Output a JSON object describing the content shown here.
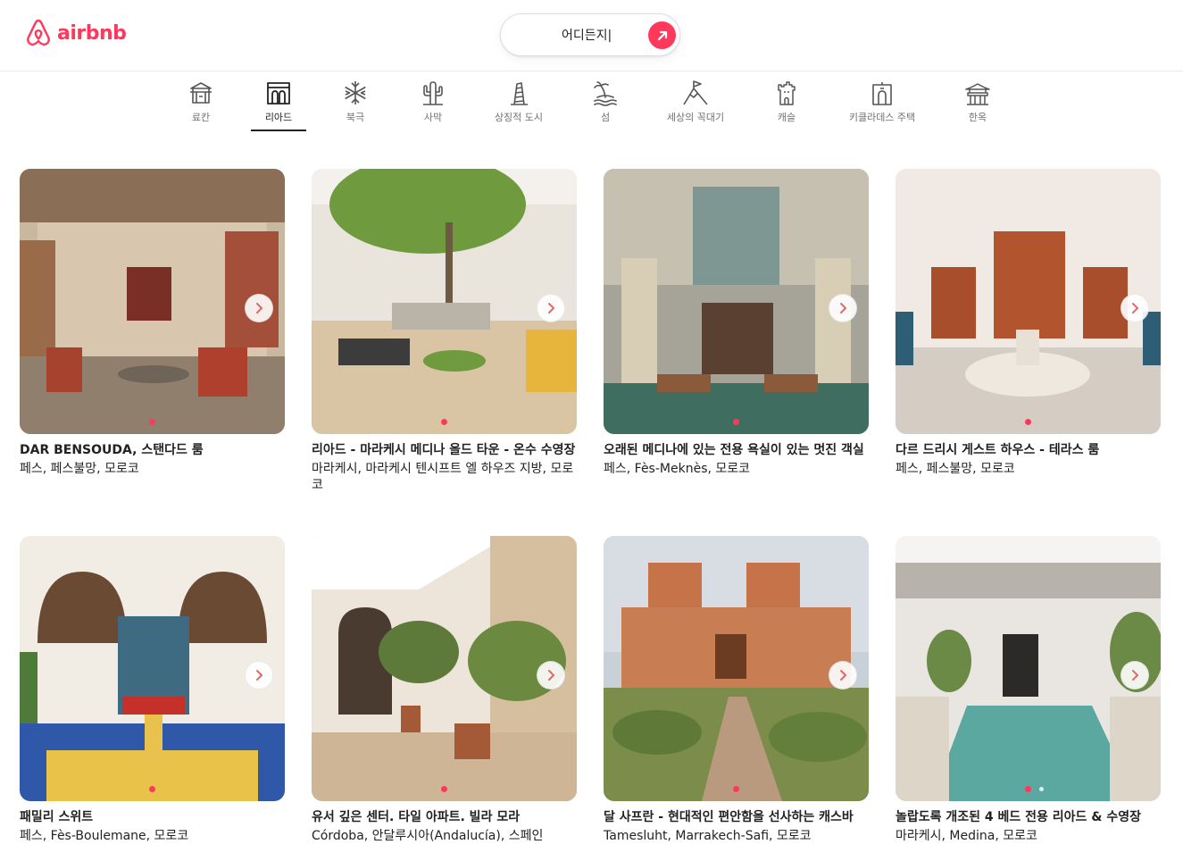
{
  "header": {
    "logo_text": "airbnb",
    "search_text": "어디든지|"
  },
  "categories": [
    {
      "label": "료칸",
      "icon": "ryokan-icon"
    },
    {
      "label": "리아드",
      "icon": "riad-icon",
      "active": true
    },
    {
      "label": "북극",
      "icon": "snowflake-icon"
    },
    {
      "label": "사막",
      "icon": "cactus-icon"
    },
    {
      "label": "상징적 도시",
      "icon": "tower-icon"
    },
    {
      "label": "섬",
      "icon": "island-icon"
    },
    {
      "label": "세상의 꼭대기",
      "icon": "mountain-flag-icon"
    },
    {
      "label": "캐슬",
      "icon": "castle-icon"
    },
    {
      "label": "키클라데스 주택",
      "icon": "cycladic-house-icon"
    },
    {
      "label": "한옥",
      "icon": "hanok-icon"
    }
  ],
  "listings": [
    {
      "title": "DAR BENSOUDA, 스탠다드 룸",
      "location": "페스, 페스불망, 모로코"
    },
    {
      "title": "리아드 - 마라케시 메디나 올드 타운 - 온수 수영장",
      "location": "마라케시, 마라케시 텐시프트 엘 하우즈 지방, 모로코"
    },
    {
      "title": "오래된 메디나에 있는 전용 욕실이 있는 멋진 객실",
      "location": "페스, Fès-Meknès, 모로코"
    },
    {
      "title": "다르 드리시 게스트 하우스 - 테라스 룸",
      "location": "페스, 페스불망, 모로코"
    },
    {
      "title": "패밀리 스위트",
      "location": "페스, Fès-Boulemane, 모로코"
    },
    {
      "title": "유서 깊은 센터. 타일 아파트. 빌라 모라",
      "location": "Córdoba, 안달루시아(Andalucía), 스페인"
    },
    {
      "title": "달 사프란 - 현대적인 편안함을 선사하는 캐스바",
      "location": "Tamesluht, Marrakech-Safi, 모로코"
    },
    {
      "title": "놀랍도록 개조된 4 베드 전용 리아드 & 수영장",
      "location": "마라케시, Medina, 모로코"
    }
  ],
  "colors": {
    "brand": "#FF385C",
    "text": "#222222",
    "muted": "#717171"
  }
}
